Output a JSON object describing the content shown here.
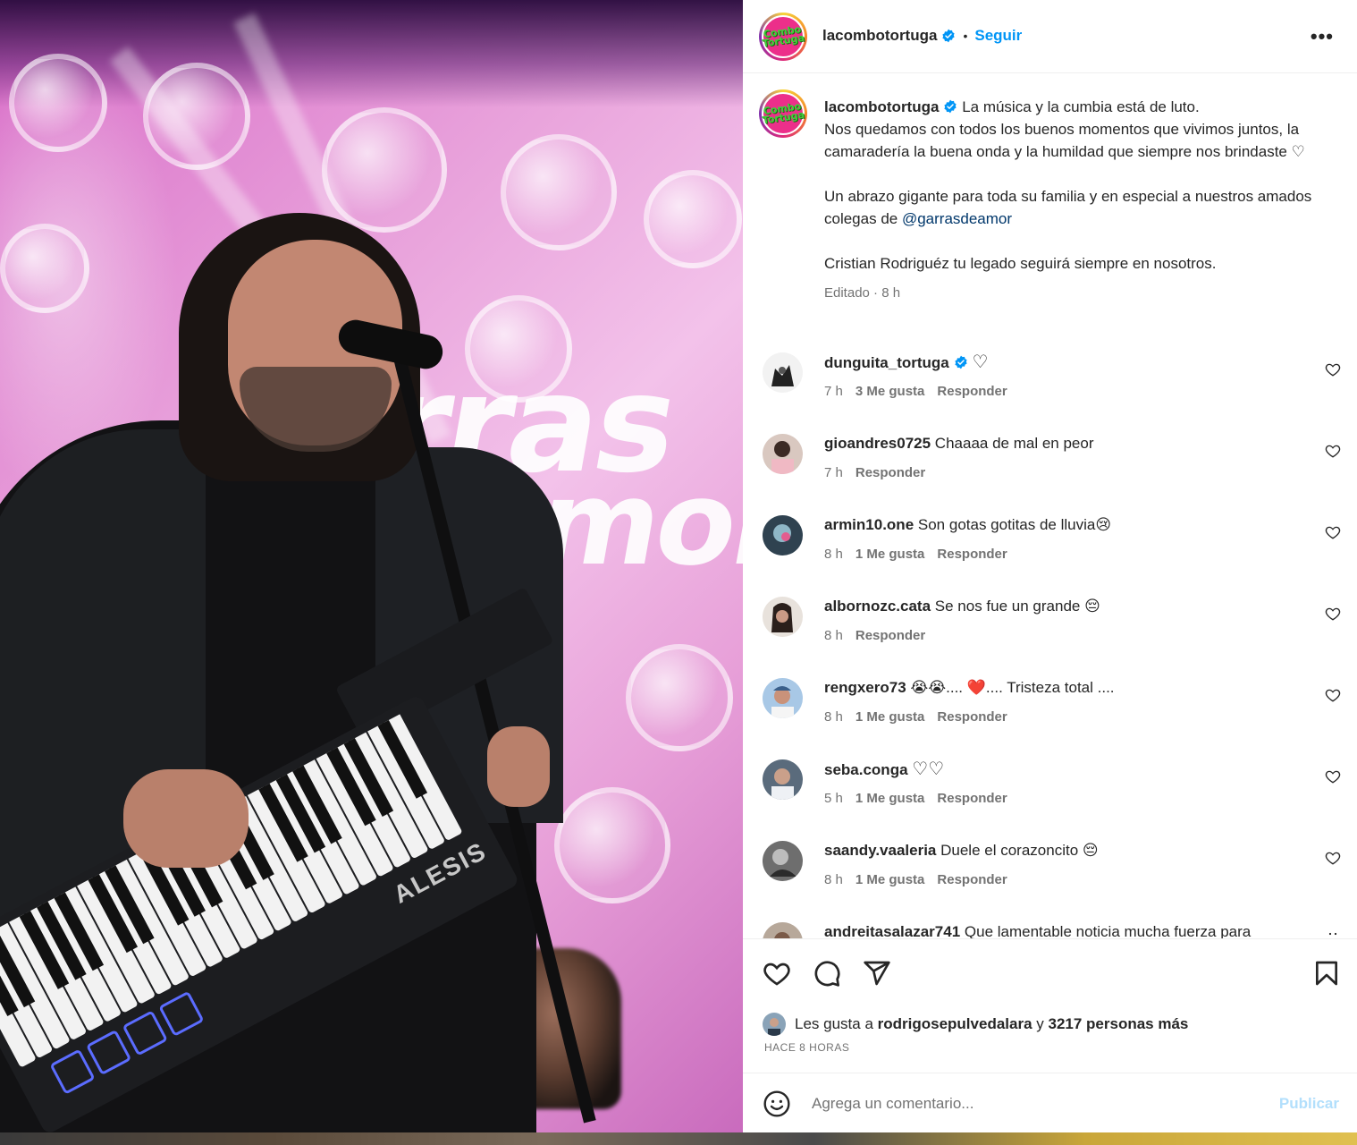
{
  "post": {
    "account": "lacombotortuga",
    "account_logo_text": "Combo Tortuga",
    "follow_label": "Seguir",
    "more_label": "•••",
    "separator": "•"
  },
  "photo": {
    "background_text_1": "rras",
    "background_text_2": "amor",
    "keytar_brand": "ALESIS"
  },
  "caption": {
    "author": "lacombotortuga",
    "line1": "La música y la cumbia está de luto.",
    "line2": "Nos quedamos con todos los buenos momentos que vivimos juntos, la camaradería la buena onda y la humildad que siempre nos brindaste ♡",
    "line3_prefix": "Un abrazo gigante para toda su familia y en especial a nuestros amados colegas de ",
    "line3_mention": "@garrasdeamor",
    "line4": "Cristian Rodriguéz tu legado seguirá siempre en nosotros.",
    "meta": "Editado · 8 h"
  },
  "comments": [
    {
      "user": "dunguita_tortuga",
      "verified": true,
      "text": "♡",
      "time": "7 h",
      "likes": "3 Me gusta",
      "reply": "Responder"
    },
    {
      "user": "gioandres0725",
      "verified": false,
      "text": "Chaaaa de mal en peor",
      "time": "7 h",
      "likes": "",
      "reply": "Responder"
    },
    {
      "user": "armin10.one",
      "verified": false,
      "text": "Son gotas gotitas de lluvia😢",
      "time": "8 h",
      "likes": "1 Me gusta",
      "reply": "Responder"
    },
    {
      "user": "albornozc.cata",
      "verified": false,
      "text": "Se nos fue un grande 😔",
      "time": "8 h",
      "likes": "",
      "reply": "Responder"
    },
    {
      "user": "rengxero73",
      "verified": false,
      "text": "😭😭.... ❤️.... Tristeza total ....",
      "time": "8 h",
      "likes": "1 Me gusta",
      "reply": "Responder"
    },
    {
      "user": "seba.conga",
      "verified": false,
      "text": "♡♡",
      "time": "5 h",
      "likes": "1 Me gusta",
      "reply": "Responder"
    },
    {
      "user": "saandy.vaaleria",
      "verified": false,
      "text": "Duele el corazoncito 😔",
      "time": "8 h",
      "likes": "1 Me gusta",
      "reply": "Responder"
    },
    {
      "user": "andreitasalazar741",
      "verified": false,
      "text": "Que lamentable noticia mucha fuerza para",
      "time": "",
      "likes": "",
      "reply": ""
    }
  ],
  "likes": {
    "prefix": "Les gusta a",
    "user": "rodrigosepulvedalara",
    "conj": "y",
    "others": "3217 personas más"
  },
  "timestamp": "HACE 8 HORAS",
  "comment_box": {
    "placeholder": "Agrega un comentario...",
    "publish_label": "Publicar"
  },
  "colors": {
    "link": "#0095f6",
    "mention": "#00376b",
    "muted": "#737373",
    "publish_disabled": "#b2dffc",
    "verified": "#0095f6"
  },
  "icons": [
    "verified-icon",
    "more-icon",
    "heart-icon",
    "comment-icon",
    "share-icon",
    "bookmark-icon",
    "emoji-icon"
  ]
}
